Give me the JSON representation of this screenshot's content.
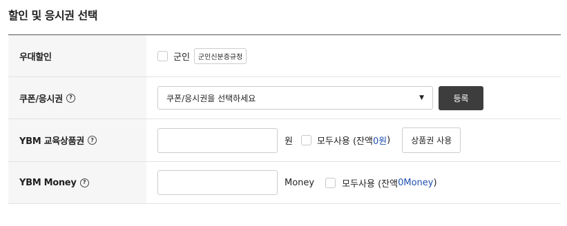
{
  "section": {
    "title": "할인 및 응시권 선택"
  },
  "rows": {
    "veteran": {
      "label": "우대할인",
      "checkbox_label": "군인",
      "rules_button": "군인신분증규정"
    },
    "coupon": {
      "label": "쿠폰/응시권",
      "help": "?",
      "select_value": "쿠폰/응시권을 선택하세요",
      "register_button": "등록"
    },
    "voucher": {
      "label": "YBM 교육상품권",
      "help": "?",
      "input_value": "",
      "unit": "원",
      "use_all_label": "모두사용 (잔액 ",
      "balance": "0원",
      "close_paren": ")",
      "apply_button": "상품권 사용"
    },
    "money": {
      "label": "YBM Money",
      "help": "?",
      "input_value": "",
      "unit": "Money",
      "use_all_label": "모두사용 (잔액 ",
      "balance": "0Money",
      "close_paren": ")"
    }
  },
  "colors": {
    "accent_blue": "#1e4fb0",
    "dark_button": "#3d3d3d",
    "label_bg": "#f6f6f6"
  }
}
